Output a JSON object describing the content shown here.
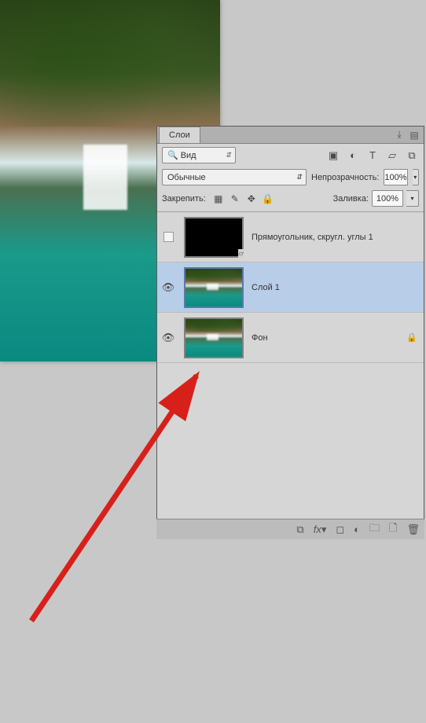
{
  "panel": {
    "tab_label": "Слои",
    "search_label": "Вид",
    "blend_mode": "Обычные",
    "opacity_label": "Непрозрачность:",
    "opacity_value": "100%",
    "lock_label": "Закрепить:",
    "fill_label": "Заливка:",
    "fill_value": "100%"
  },
  "layers": [
    {
      "visible": false,
      "name": "Прямоугольник, скругл. углы 1",
      "type": "shape",
      "locked": false
    },
    {
      "visible": true,
      "name": "Слой 1",
      "type": "image",
      "locked": false,
      "selected": true
    },
    {
      "visible": true,
      "name": "Фон",
      "type": "image",
      "locked": true
    }
  ],
  "icons": {
    "image": "image-icon",
    "adjust": "adjustment-icon",
    "text": "text-icon",
    "transform": "transform-icon",
    "smart": "smart-object-icon",
    "pixels": "lock-pixels-icon",
    "brush": "lock-brush-icon",
    "move": "lock-move-icon",
    "lock": "lock-icon",
    "link": "link-icon",
    "fx": "fx-icon",
    "mask": "mask-icon",
    "fill": "fill-adjust-icon",
    "group": "group-icon",
    "new": "new-layer-icon",
    "trash": "trash-icon"
  }
}
